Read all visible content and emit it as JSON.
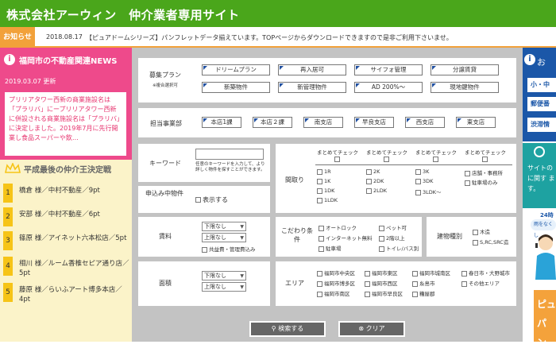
{
  "header": {
    "title": "株式会社アーウィン　仲介業者専用サイト"
  },
  "notice": {
    "tag": "お知らせ",
    "date": "2018.08.17",
    "text": "【ピュアドームシリーズ】パンフレットデータ揃えています。TOPページからダウンロードできますので是非ご利用下さいませ。"
  },
  "left": {
    "news_heading": "福岡市の不動産関連NEWS",
    "news_date": "2019.03.07 更新",
    "news_text": "プリリアタワー西新の商業施設名は「プラリバ」にープリリアタワー西新に併設される商業施設名は「プラリバ」に決定しました。2019年7月に先行開業し食品スーパーや飲…",
    "ranking_heading": "平成最後の仲介王決定戦",
    "ranking": [
      {
        "num": "1",
        "name": "橋倉 様／中村不動産／9pt"
      },
      {
        "num": "2",
        "name": "安部 様／中村不動産／6pt"
      },
      {
        "num": "3",
        "name": "篠原 様／アイネット六本松店／5pt"
      },
      {
        "num": "4",
        "name": "相川 様／ルーム香椎セピア通り店／5pt"
      },
      {
        "num": "5",
        "name": "藤原 様／らいふアート博多本店／4pt"
      }
    ]
  },
  "search": {
    "plan_label": "募集プラン",
    "plan_note": "※複合選択可",
    "plans": [
      "ドリームプラン",
      "再入居可",
      "サイフォ管理",
      "分譲賃貸",
      "新築物件",
      "新管理物件",
      "AD 200%～",
      "現地鍵物件"
    ],
    "office_label": "担当事業部",
    "offices": [
      "本店1課",
      "本店２課",
      "南支店",
      "早良支店",
      "西支店",
      "東支店"
    ],
    "keyword_label": "キーワード",
    "keyword_help": "任意のキーワードを入力して、より詳しく物件を探すことができます。",
    "app_label": "申込み中物件",
    "app_option": "表示する",
    "layout_label": "間取り",
    "layout_groups": [
      {
        "head": "まとめてチェック",
        "items": [
          "1R",
          "1K",
          "1DK",
          "1LDK"
        ]
      },
      {
        "head": "まとめてチェック",
        "items": [
          "2K",
          "2DK",
          "2LDK"
        ]
      },
      {
        "head": "まとめてチェック",
        "items": [
          "3K",
          "3DK",
          "3LDK～"
        ]
      },
      {
        "head": "まとめてチェック",
        "items": [
          "店舗・事務所",
          "駐車場のみ"
        ]
      }
    ],
    "rent_label": "賃料",
    "rent_min": "下限なし",
    "rent_max": "上限なし",
    "rent_option": "共益費・管理費込み",
    "pref_label": "こだわり条件",
    "prefs": [
      "オートロック",
      "ペット可",
      "インターネット無料",
      "2階以上",
      "駐車場",
      "トイレ/バス別"
    ],
    "structure_label": "建物種別",
    "structures": [
      "木造",
      "S,RC,SRC造"
    ],
    "area_label": "面積",
    "area_min": "下限なし",
    "area_max": "上限なし",
    "region_label": "エリア",
    "regions": [
      "福岡市中央区",
      "福岡市東区",
      "福岡市城南区",
      "春日市・大野城市",
      "福岡市博多区",
      "福岡市西区",
      "糸島市",
      "その他エリア",
      "福岡市南区",
      "福岡市早良区",
      "糟屋郡"
    ],
    "search_button": "検索する",
    "clear_button": "クリア"
  },
  "right": {
    "heading": "お",
    "buttons": [
      "小・中",
      "郵便番",
      "渋滞情"
    ],
    "teal_text": "サイトの に関す ます。",
    "hours": "24時",
    "hours_sub": "雨をなくし",
    "banner": "ピュ パン"
  },
  "colors": {
    "header": "#4aa61b",
    "notice": "#f2a13a",
    "news": "#ee4a8b",
    "ranking_bg": "#fbf3c9",
    "ranking_num": "#f6c417",
    "right_blue": "#1b57a8",
    "right_teal": "#1ea2a1"
  }
}
